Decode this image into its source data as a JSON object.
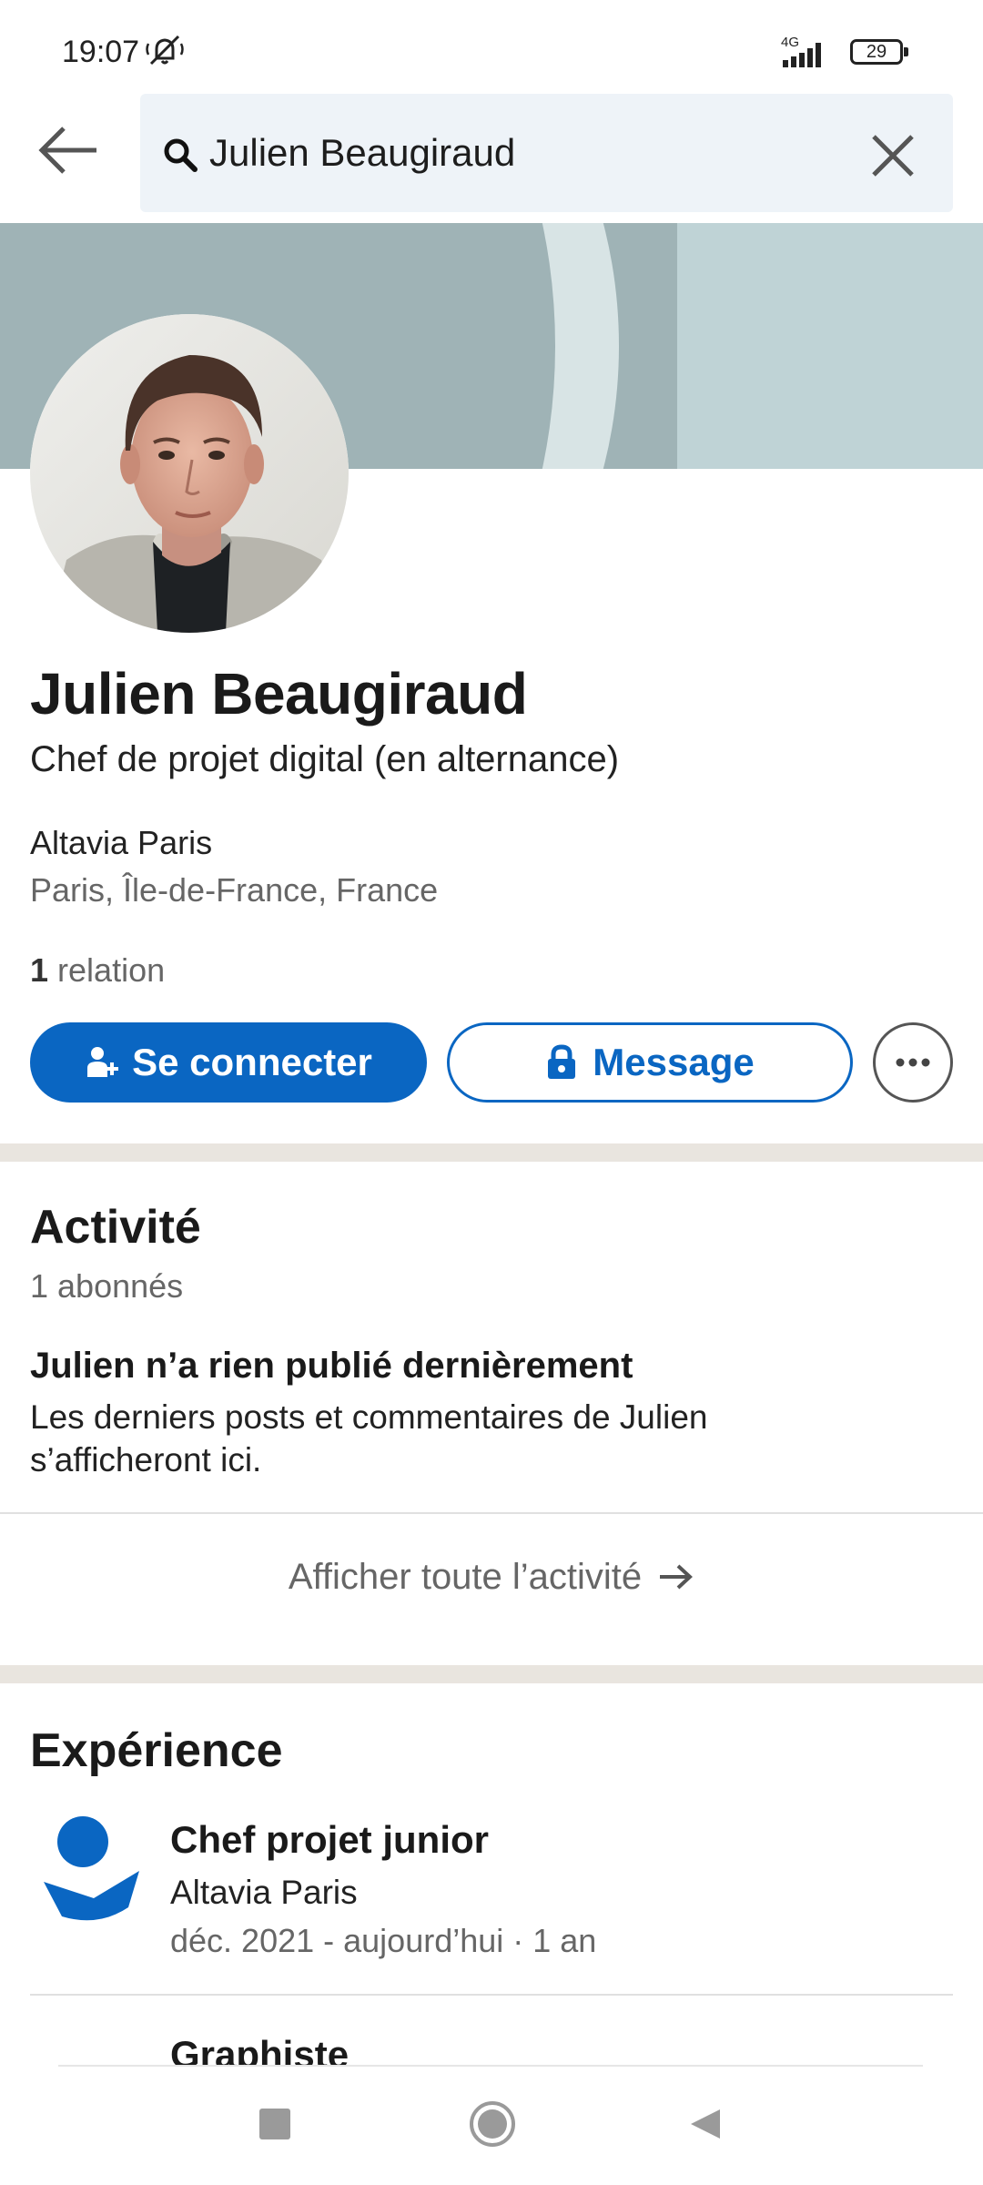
{
  "status_bar": {
    "time": "19:07",
    "network": "4G",
    "battery": "29",
    "icons": [
      "mute-icon",
      "signal-icon",
      "battery-icon"
    ]
  },
  "search": {
    "query": "Julien Beaugiraud",
    "icons": [
      "back-arrow-icon",
      "search-icon",
      "close-icon"
    ]
  },
  "profile": {
    "name": "Julien Beaugiraud",
    "headline": "Chef de projet digital (en alternance)",
    "company": "Altavia Paris",
    "location": "Paris, Île-de-France, France",
    "relations_count": "1",
    "relations_label": " relation"
  },
  "actions": {
    "connect_label": "Se connecter",
    "message_label": "Message",
    "icons": [
      "add-person-icon",
      "lock-icon",
      "more-icon"
    ]
  },
  "activity": {
    "title": "Activité",
    "followers": "1 abonnés",
    "empty_title": "Julien n’a rien publié dernièrement",
    "empty_desc": "Les derniers posts et commentaires de Julien s’afficheront ici.",
    "show_all": "Afficher toute l’activité",
    "icons": [
      "arrow-right-icon"
    ]
  },
  "experience": {
    "title": "Expérience",
    "items": [
      {
        "role": "Chef projet junior",
        "company": "Altavia Paris",
        "dates": "déc. 2021 - aujourd’hui · 1 an"
      },
      {
        "role": "Graphiste"
      }
    ]
  },
  "colors": {
    "brand_blue": "#0a66c2",
    "search_bg": "#eef3f8",
    "separator": "#e9e5df"
  },
  "nav_icons": [
    "recents-icon",
    "home-icon",
    "back-icon"
  ]
}
